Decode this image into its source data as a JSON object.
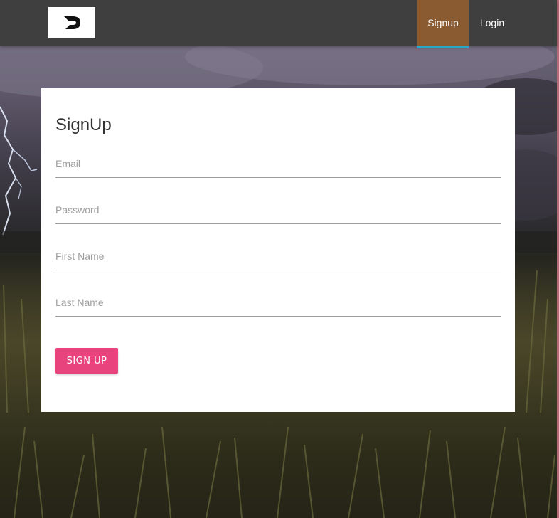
{
  "navbar": {
    "logo_icon": "d-logo-icon",
    "items": [
      {
        "label": "Signup",
        "active": true
      },
      {
        "label": "Login",
        "active": false
      }
    ],
    "active_color": "#8a5a31",
    "active_underline_color": "#26a9c9"
  },
  "form": {
    "title": "SignUp",
    "fields": [
      {
        "placeholder": "Email",
        "value": ""
      },
      {
        "placeholder": "Password",
        "value": ""
      },
      {
        "placeholder": "First Name",
        "value": ""
      },
      {
        "placeholder": "Last Name",
        "value": ""
      }
    ],
    "submit_label": "SIGN UP",
    "submit_color": "#e8437c"
  }
}
